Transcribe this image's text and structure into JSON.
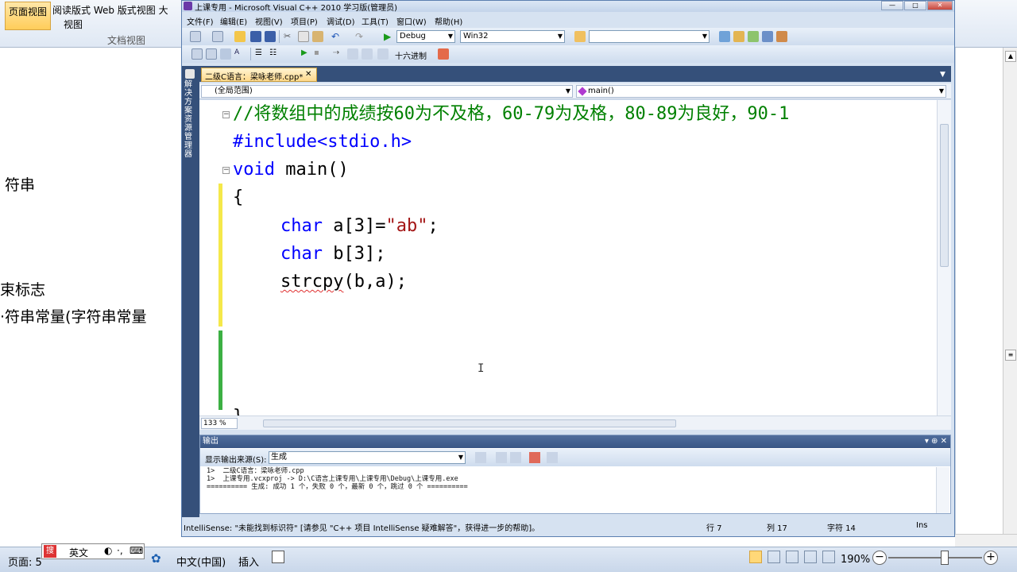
{
  "word": {
    "ribbon": {
      "page_view": "页面视图",
      "read_view_line1": "阅读版式 Web 版式视图 大",
      "read_view_line2": "视图",
      "group_label": "文档视图"
    },
    "doc_lines": [
      "符串",
      "束标志",
      "·符串常量(字符串常量"
    ],
    "status": {
      "page": "页面: 5",
      "ime_lang": "英文",
      "lang": "中文(中国)",
      "insert": "插入",
      "zoom": "190%"
    }
  },
  "vs": {
    "title": "上课专用 - Microsoft Visual C++ 2010 学习版(管理员)",
    "menu": [
      "文件(F)",
      "编辑(E)",
      "视图(V)",
      "项目(P)",
      "调试(D)",
      "工具(T)",
      "窗口(W)",
      "帮助(H)"
    ],
    "toolbar": {
      "config": "Debug",
      "platform": "Win32",
      "find": "",
      "hex_label": "十六进制"
    },
    "sidetab_label": "解决方案资源管理器",
    "doc_tab": "二级C语言：梁咏老师.cpp*",
    "nav": {
      "scope": "(全局范围)",
      "member": "main()"
    },
    "code": {
      "line1_comment": "//将数组中的成绩按60为不及格，60-79为及格，80-89为良好，90-1",
      "line2_include": "#include<stdio.h>",
      "line3_void": "void",
      "line3_rest": " main()",
      "line4": "{",
      "line5_kw": "char",
      "line5_rest_a": " a[3]=",
      "line5_str": "\"ab\"",
      "line5_end": ";",
      "line6_kw": "char",
      "line6_rest": " b[3];",
      "line7_fn": "strcpy",
      "line7_rest": "(b,a);",
      "line8": "}"
    },
    "zoom_level": "133 %",
    "output": {
      "title": "输出",
      "source_label": "显示输出来源(S):",
      "source_value": "生成",
      "lines": [
        "1>  二级C语言：梁咏老师.cpp",
        "1>  上课专用.vcxproj -> D:\\C语言上课专用\\上课专用\\Debug\\上课专用.exe",
        "========== 生成: 成功 1 个，失败 0 个，最新 0 个，跳过 0 个 =========="
      ]
    },
    "status": {
      "message": "IntelliSense: \"未能找到标识符\" [请参见 \"C++ 项目 IntelliSense 疑难解答\"，获得进一步的帮助]。",
      "row": "行 7",
      "col": "列 17",
      "char": "字符 14",
      "mode": "Ins"
    }
  }
}
